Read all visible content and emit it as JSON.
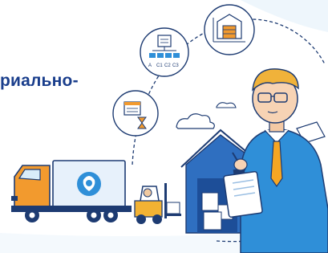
{
  "banner": {
    "heading_fragment": "риально-",
    "colors": {
      "heading": "#1a3e8c",
      "truck_cab": "#f29a2e",
      "trailer": "#e7f1fb",
      "outline": "#1d3b72",
      "accent_blue": "#2f8fd8",
      "forklift": "#f2b233",
      "shirt": "#2f8fd8",
      "tie": "#f5a623",
      "hair": "#f0b23a"
    },
    "icons": [
      {
        "name": "calendar-hourglass-icon"
      },
      {
        "name": "org-chart-icon",
        "labels": [
          "A",
          "C1",
          "C2",
          "C3"
        ]
      },
      {
        "name": "warehouse-icon"
      }
    ]
  }
}
